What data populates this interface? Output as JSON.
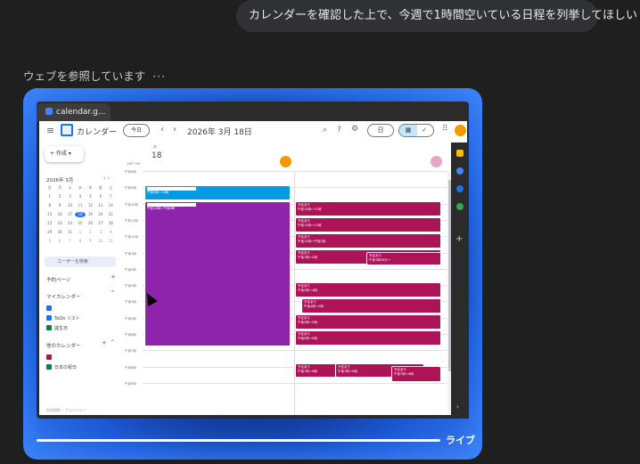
{
  "chat": {
    "user_message": "カレンダーを確認した上で、今週で1時間空いている日程を列挙してほしい",
    "status_text": "ウェブを参照しています",
    "status_dots": "···"
  },
  "live": {
    "label": "ライブ"
  },
  "browser": {
    "tab_title": "calendar.g..."
  },
  "calendar": {
    "app_title": "カレンダー",
    "today_button": "今日",
    "prev_icon": "‹",
    "next_icon": "›",
    "date_title": "2026年 3月 18日",
    "view_selector": "日",
    "toggle_left": "▦",
    "toggle_right": "✓",
    "create_button": "+ 作成 ▾",
    "mini_title": "2026年 3月",
    "mini_nav": "‹ ›",
    "mini_weekdays": [
      "日",
      "月",
      "火",
      "水",
      "木",
      "金",
      "土"
    ],
    "mini_days": [
      "1",
      "2",
      "3",
      "4",
      "5",
      "6",
      "7",
      "8",
      "9",
      "10",
      "11",
      "12",
      "13",
      "14",
      "15",
      "16",
      "17",
      "18",
      "19",
      "20",
      "21",
      "22",
      "23",
      "24",
      "25",
      "26",
      "27",
      "28",
      "29",
      "30",
      "31",
      "1",
      "2",
      "3",
      "4",
      "5",
      "6",
      "7",
      "8",
      "9",
      "10",
      "11"
    ],
    "mini_today": "18",
    "people_search": "ユーザーを検索",
    "booking_pages": "予約ページ",
    "my_calendars": "マイカレンダー",
    "my_calendar_items": [
      "",
      "ToDo リスト",
      "誕生日"
    ],
    "other_calendars": "他のカレンダー",
    "other_calendar_items": [
      "",
      "日本の祝日"
    ],
    "footer": "利用規約 – プライバシー",
    "day_abbr": "水",
    "day_number": "18",
    "timezone": "GMT+09",
    "hours": [
      "午前8時",
      "午前9時",
      "午前10時",
      "午前11時",
      "午後12時",
      "午後1時",
      "午後2時",
      "午後3時",
      "午後4時",
      "午後5時",
      "午後6時",
      "午後7時",
      "午後8時",
      "午後9時"
    ],
    "events": [
      {
        "title": "",
        "time": "午前9時～10時",
        "color": "#039be5"
      },
      {
        "title": "",
        "time": "午前10時～午後6時",
        "color": "#8e24aa"
      },
      {
        "title": "予定あり",
        "time": "午前10時～11時",
        "color": "#ad1457"
      },
      {
        "title": "予定あり",
        "time": "午前11時～12時",
        "color": "#ad1457"
      },
      {
        "title": "予定あり",
        "time": "午後12時～午後1時",
        "color": "#ad1457"
      },
      {
        "title": "予定あり",
        "time": "午後1時～2時",
        "color": "#ad1457"
      },
      {
        "title": "予定あり",
        "time": "午後1時30分～",
        "color": "#ad1457"
      },
      {
        "title": "予定あり",
        "time": "午後3時～4時",
        "color": "#ad1457"
      },
      {
        "title": "予定あり",
        "time": "午後4時～5時",
        "color": "#ad1457"
      },
      {
        "title": "予定あり",
        "time": "午後4時～5時",
        "color": "#ad1457"
      },
      {
        "title": "予定あり",
        "time": "午後5時～6時",
        "color": "#ad1457"
      },
      {
        "title": "予定あり",
        "time": "午後7時～8時",
        "color": "#ad1457"
      },
      {
        "title": "予定あり",
        "time": "午後7時～8時",
        "color": "#ad1457"
      },
      {
        "title": "予定あり",
        "time": "午後7時～8時",
        "color": "#ad1457"
      }
    ]
  },
  "colors": {
    "background": "#1f1f1f",
    "bubble": "#303134",
    "accent_blue": "#1a73e8",
    "event_purple": "#8e24aa",
    "event_red": "#ad1457",
    "event_blue": "#039be5",
    "avatar_orange": "#f29900"
  }
}
